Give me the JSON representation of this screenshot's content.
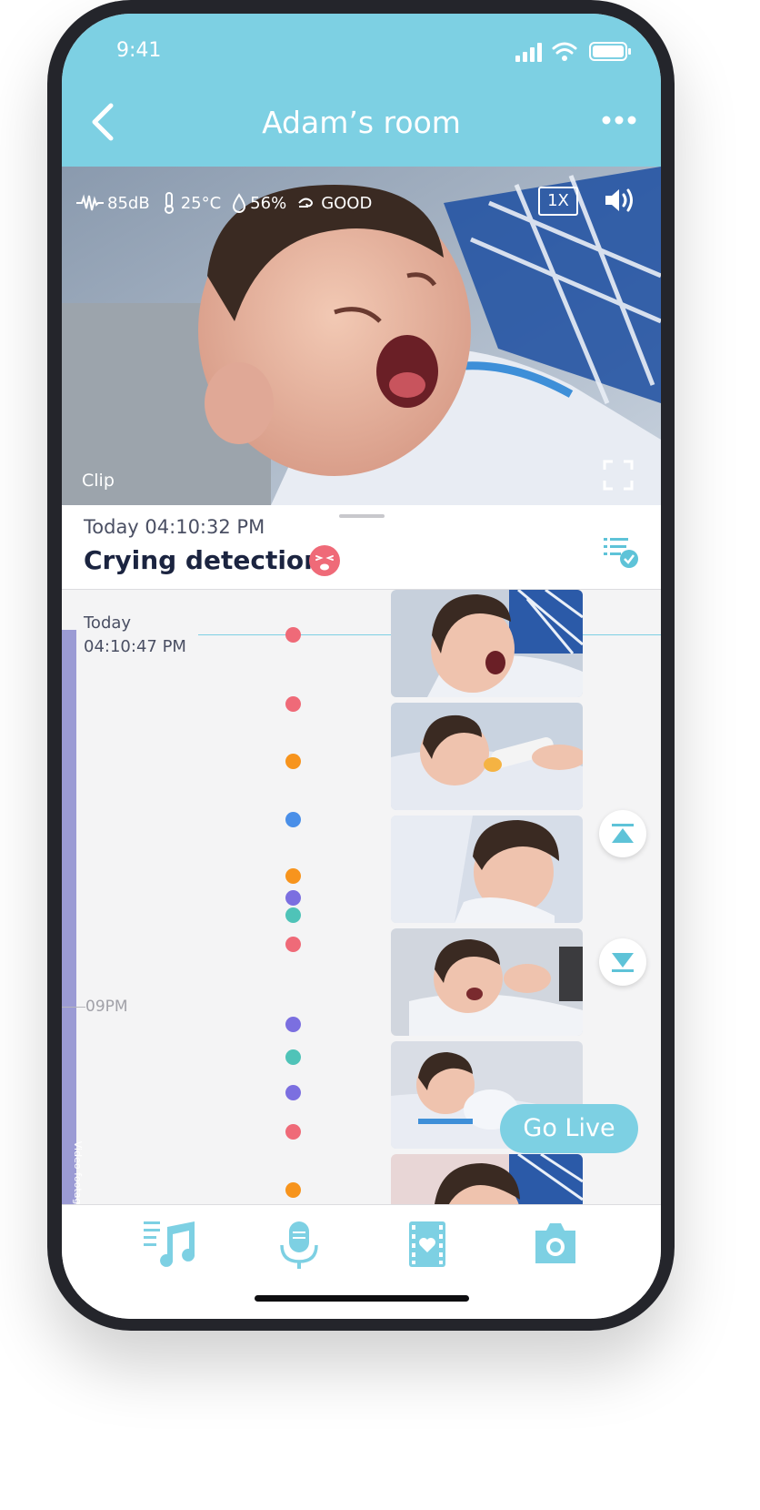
{
  "status": {
    "time": "9:41"
  },
  "header": {
    "title": "Adam’s room"
  },
  "video": {
    "sound": "85dB",
    "temperature": "25°C",
    "humidity": "56%",
    "air_quality": "GOOD",
    "zoom": "1X",
    "clip_label": "Clip"
  },
  "event": {
    "time": "Today 04:10:32 PM",
    "title": "Crying detection"
  },
  "timeline": {
    "now_day": "Today",
    "now_time": "04:10:47 PM",
    "tick_label": "09PM",
    "footage_label": "Video footage",
    "dot_colors": [
      "#ef6a78",
      "#ef6a78",
      "#f7941d",
      "#4a8fe8",
      "#f7941d",
      "#7b6fe0",
      "#4fc3b8",
      "#ef6a78",
      "#7b6fe0",
      "#4fc3b8",
      "#7b6fe0",
      "#ef6a78",
      "#f7941d"
    ]
  },
  "buttons": {
    "go_live": "Go Live"
  },
  "bottom_nav": [
    "music-playlist-icon",
    "microphone-icon",
    "video-favorites-icon",
    "camera-icon"
  ],
  "colors": {
    "accent": "#7dd0e3",
    "cry": "#ef6a78",
    "frame": "#24252b"
  }
}
